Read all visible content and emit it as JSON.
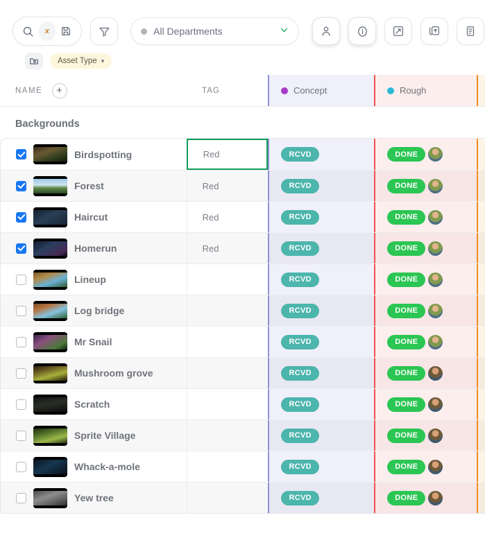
{
  "toolbar": {
    "search_icon": "search-icon",
    "clear_label": "x",
    "save_icon": "save-disk-icon",
    "filter_icon": "filter-funnel-icon",
    "department_select": {
      "value": "All Departments",
      "chevron": "chevron-down-icon"
    },
    "buttons": [
      {
        "name": "person-icon",
        "pressed": true
      },
      {
        "name": "info-icon",
        "pressed": true
      },
      {
        "name": "expand-arrows-icon",
        "pressed": false
      },
      {
        "name": "upload-copy-icon",
        "pressed": false
      },
      {
        "name": "clipboard-icon",
        "pressed": false
      }
    ]
  },
  "filterbar": {
    "group_icon": "folder-group-icon",
    "chip_label": "Asset Type",
    "chip_chevron": "chevron-down-icon",
    "chip_bg": "#fdf6dd"
  },
  "columns": {
    "name": {
      "label": "NAME",
      "add_button": "+"
    },
    "tag": {
      "label": "TAG"
    },
    "concept": {
      "label": "Concept",
      "dot_color": "#a63cc9",
      "bg": "#f0f0fa",
      "border": "#8f8fd6"
    },
    "rough": {
      "label": "Rough",
      "dot_color": "#2bb8d4",
      "bg": "#fdeeee",
      "border": "#ef5350"
    },
    "extra": {
      "bg": "#fdf4e8",
      "border": "#f28b20"
    }
  },
  "group": {
    "title": "Backgrounds"
  },
  "selected_cell": {
    "row": 0,
    "column": "tag",
    "border_color": "#0f9d58"
  },
  "rows": [
    {
      "name": "Birdspotting",
      "checked": true,
      "tag": "Red",
      "concept": "RCVD",
      "rough": "DONE",
      "avatar": "a"
    },
    {
      "name": "Forest",
      "checked": true,
      "tag": "Red",
      "concept": "RCVD",
      "rough": "DONE",
      "avatar": "a"
    },
    {
      "name": "Haircut",
      "checked": true,
      "tag": "Red",
      "concept": "RCVD",
      "rough": "DONE",
      "avatar": "a"
    },
    {
      "name": "Homerun",
      "checked": true,
      "tag": "Red",
      "concept": "RCVD",
      "rough": "DONE",
      "avatar": "a"
    },
    {
      "name": "Lineup",
      "checked": false,
      "tag": "",
      "concept": "RCVD",
      "rough": "DONE",
      "avatar": "a"
    },
    {
      "name": "Log bridge",
      "checked": false,
      "tag": "",
      "concept": "RCVD",
      "rough": "DONE",
      "avatar": "a"
    },
    {
      "name": "Mr Snail",
      "checked": false,
      "tag": "",
      "concept": "RCVD",
      "rough": "DONE",
      "avatar": "a"
    },
    {
      "name": "Mushroom grove",
      "checked": false,
      "tag": "",
      "concept": "RCVD",
      "rough": "DONE",
      "avatar": "b"
    },
    {
      "name": "Scratch",
      "checked": false,
      "tag": "",
      "concept": "RCVD",
      "rough": "DONE",
      "avatar": "b"
    },
    {
      "name": "Sprite Village",
      "checked": false,
      "tag": "",
      "concept": "RCVD",
      "rough": "DONE",
      "avatar": "b"
    },
    {
      "name": "Whack-a-mole",
      "checked": false,
      "tag": "",
      "concept": "RCVD",
      "rough": "DONE",
      "avatar": "b"
    },
    {
      "name": "Yew tree",
      "checked": false,
      "tag": "",
      "concept": "RCVD",
      "rough": "DONE",
      "avatar": "b"
    }
  ],
  "thumbnails": [
    "linear-gradient(160deg,#3a2c1c 0%,#6a5a32 35%,#2f3d1e 70%,#15180c 100%)",
    "linear-gradient(180deg,#9ec9e8 0%,#cfe3ee 42%,#5f8a4c 62%,#2c4a24 100%)",
    "linear-gradient(150deg,#14202f 0%,#283f56 45%,#1a2433 100%)",
    "linear-gradient(150deg,#101a2c 0%,#2a3e60 40%,#462a55 80%,#120f1c 100%)",
    "linear-gradient(160deg,#7d5a2b 0%,#b08b4a 30%,#6ab0d8 62%,#2e5a28 100%)",
    "linear-gradient(160deg,#7a4f2e 0%,#b5743f 28%,#84c3e0 60%,#2f5f33 100%)",
    "linear-gradient(150deg,#3a2550 0%,#8a4f7d 35%,#4c7a3a 75%,#16220f 100%)",
    "linear-gradient(165deg,#2c1d10 0%,#6b5a22 30%,#a8b03a 62%,#221a08 100%)",
    "linear-gradient(170deg,#141414 0%,#2a2f25 45%,#0d0d0d 100%)",
    "linear-gradient(165deg,#1e2c12 0%,#5b7a2c 38%,#9bb84a 68%,#23320f 100%)",
    "linear-gradient(150deg,#0b1622 0%,#16364f 45%,#0a1018 100%)",
    "linear-gradient(160deg,#4a4a4a 0%,#8d8d8d 40%,#5e5e5e 72%,#2a2a2a 100%)"
  ],
  "avatars": {
    "a": "radial-gradient(circle at 50% 34%, #e2b48c 0 26%, #7f9a4e 27% 58%, #4f6f86 59% 100%)",
    "b": "radial-gradient(circle at 50% 34%, #d8a076 0 27%, #6d5a3a 28% 57%, #3f5a6e 58% 100%)"
  }
}
